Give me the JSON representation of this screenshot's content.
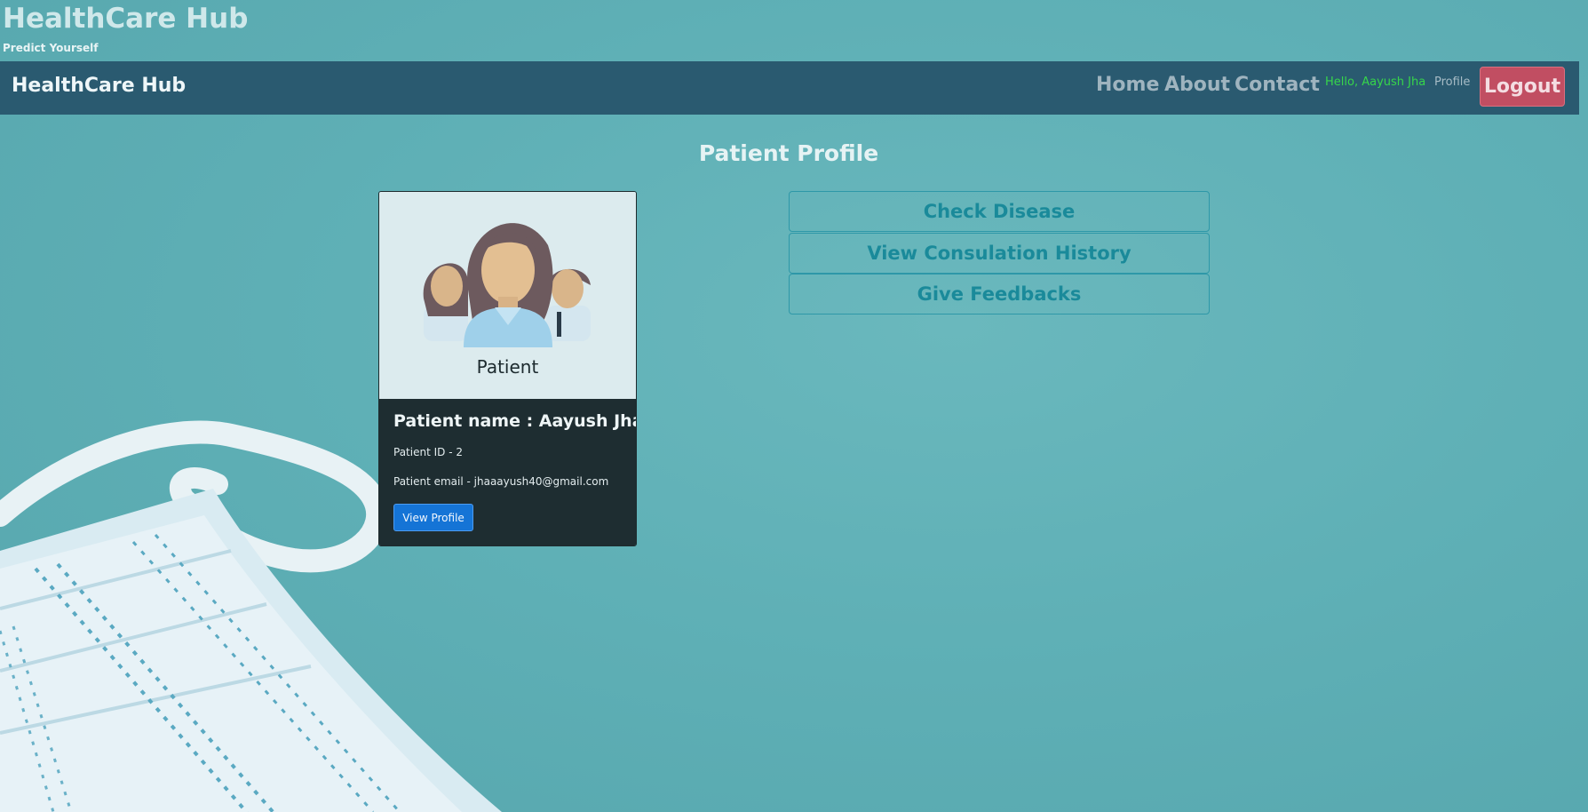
{
  "header": {
    "site_title": "HealthCare Hub",
    "tagline": "Predict Yourself"
  },
  "navbar": {
    "brand": "HealthCare Hub",
    "links": {
      "home": "Home",
      "about": "About",
      "contact": "Contact"
    },
    "greeting": "Hello, Aayush Jha",
    "profile": "Profile",
    "logout": "Logout"
  },
  "main": {
    "page_title": "Patient Profile",
    "card": {
      "image_label": "Patient",
      "name": "Patient name : Aayush Jha",
      "id": "Patient ID - 2",
      "email": "Patient email - jhaaayush40@gmail.com",
      "button": "View Profile"
    },
    "actions": {
      "check_disease": "Check Disease",
      "history": "View Consulation History",
      "feedback": "Give Feedbacks"
    }
  },
  "colors": {
    "background": "#5fb0b6",
    "navbar": "#2a5a70",
    "logout": "#c14e62",
    "greeting": "#36d64a",
    "action_text": "#1a8a9a",
    "primary_button": "#1574d6"
  },
  "icons": {
    "card_image": "patients-group-icon",
    "background": "face-mask-illustration"
  }
}
